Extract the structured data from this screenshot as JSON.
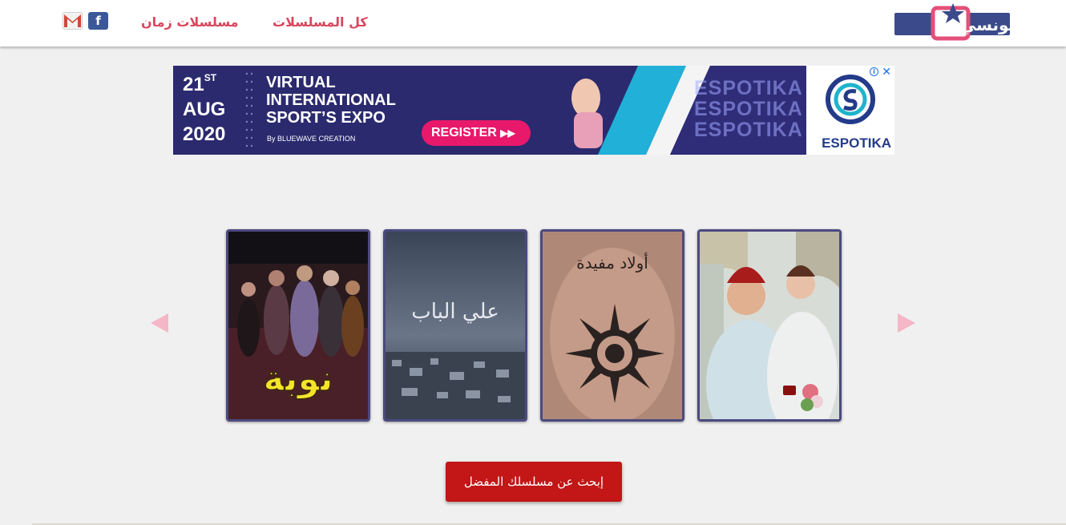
{
  "header": {
    "logo_label": "تونسي",
    "nav": [
      {
        "label": "كل المسلسلات"
      },
      {
        "label": "مسلسلات زمان"
      }
    ],
    "social": [
      {
        "icon": "gmail-icon"
      },
      {
        "icon": "facebook-icon",
        "glyph": "f"
      }
    ]
  },
  "ad": {
    "date_day": "21",
    "date_suffix": "ST",
    "date_month": "AUG",
    "date_year": "2020",
    "title_line1": "VIRTUAL",
    "title_line2": "INTERNATIONAL",
    "title_line3": "SPORT’S EXPO",
    "by": "By BLUEWAVE CREATION",
    "register": "REGISTER",
    "brand": "ESPOTIKA",
    "close": "✕",
    "info": "i"
  },
  "carousel": {
    "cards": [
      {
        "caption": "نوبة"
      },
      {
        "caption": "علي الباب"
      },
      {
        "caption": "أولاد مفيدة"
      },
      {
        "caption": ""
      }
    ]
  },
  "search_button": "إبحث عن مسلسلك المفضل",
  "colors": {
    "accent": "#d9475e",
    "button": "#c21617",
    "card_border": "#4b4a80",
    "arrow": "#f5b6c8"
  }
}
